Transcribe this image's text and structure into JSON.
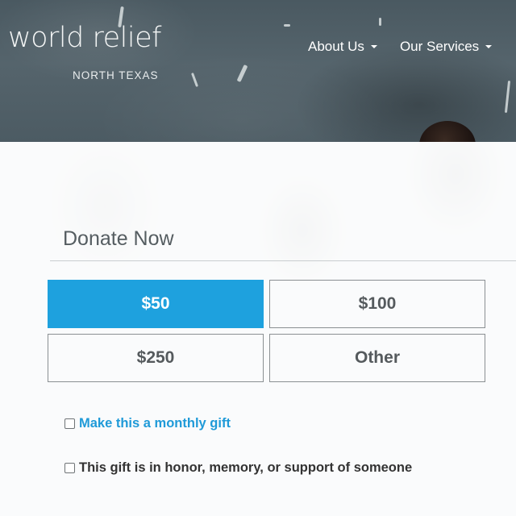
{
  "header": {
    "logo": {
      "word": "world relief",
      "sub": "NORTH TEXAS"
    },
    "nav": [
      {
        "label": "About Us"
      },
      {
        "label": "Our Services"
      }
    ]
  },
  "donate": {
    "title": "Donate Now",
    "amounts": [
      {
        "label": "$50",
        "selected": true
      },
      {
        "label": "$100",
        "selected": false
      },
      {
        "label": "$250",
        "selected": false
      },
      {
        "label": "Other",
        "selected": false
      }
    ],
    "monthly_label": "Make this a monthly gift",
    "honor_label": "This gift is in honor, memory, or support of someone"
  },
  "colors": {
    "accent": "#1ea1de",
    "link": "#1f9ad8",
    "text": "#333333"
  }
}
